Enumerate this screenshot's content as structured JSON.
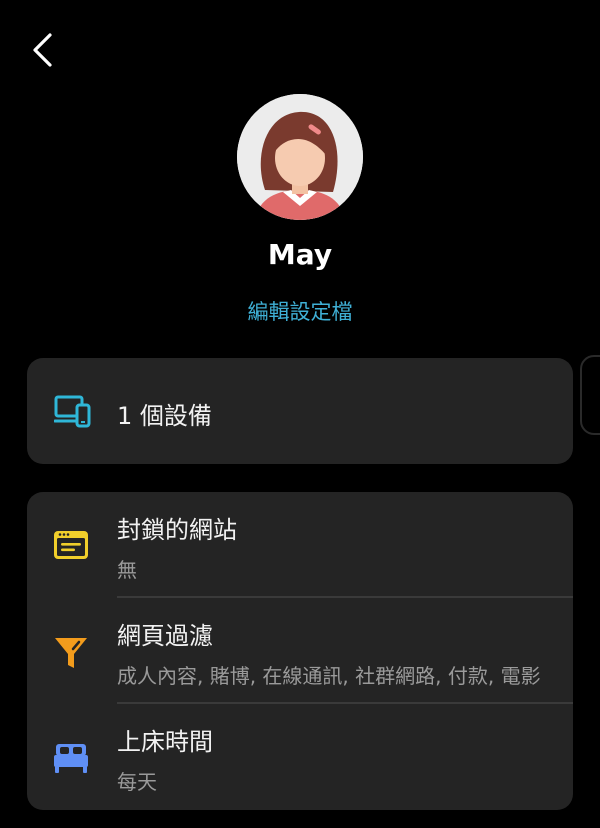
{
  "header": {
    "back_icon": "chevron-left-icon"
  },
  "profile": {
    "name": "May",
    "edit_label": "編輯設定檔",
    "avatar_icon": "girl-avatar"
  },
  "devices": {
    "icon": "devices-icon",
    "icon_color": "#2fb7d8",
    "label": "1 個設備"
  },
  "settings": [
    {
      "icon": "browser-window-icon",
      "icon_color": "#f1cf2b",
      "title": "封鎖的網站",
      "subtitle": "無"
    },
    {
      "icon": "filter-icon",
      "icon_color": "#f39c1c",
      "title": "網頁過濾",
      "subtitle": "成人內容, 賭博, 在線通訊, 社群網路, 付款, 電影"
    },
    {
      "icon": "bed-icon",
      "icon_color": "#5f8ff5",
      "title": "上床時間",
      "subtitle": "每天"
    }
  ],
  "colors": {
    "background": "#000000",
    "card": "#242424",
    "accent": "#3fb0d6",
    "primary_text": "#f2f2f2",
    "secondary_text": "#9a9a9a"
  }
}
